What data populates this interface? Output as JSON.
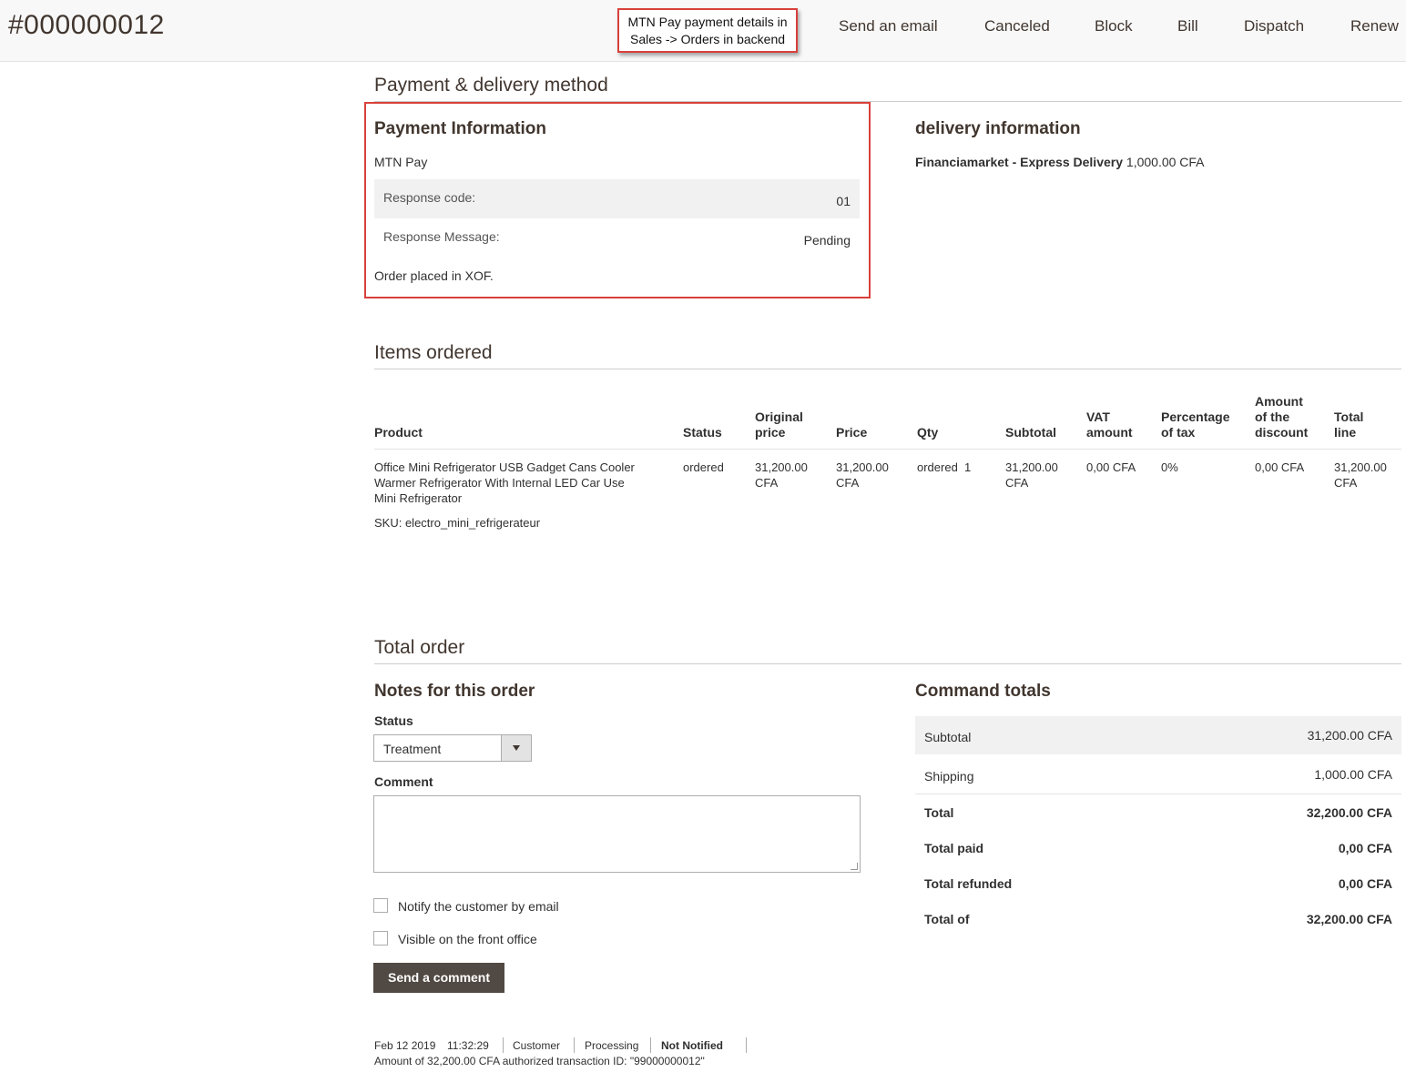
{
  "header": {
    "order_id": "#000000012",
    "callout": [
      "MTN Pay payment details in",
      "Sales -> Orders in backend"
    ],
    "actions": [
      "Send an email",
      "Canceled",
      "Block",
      "Bill",
      "Dispatch",
      "Renew"
    ]
  },
  "payment_delivery": {
    "section_title": "Payment & delivery method",
    "payment": {
      "title": "Payment Information",
      "method": "MTN Pay",
      "response_code_label": "Response code:",
      "response_code": "01",
      "response_message_label": "Response Message:",
      "response_message": "Pending",
      "currency_note": "Order placed in XOF."
    },
    "delivery": {
      "title": "delivery information",
      "method": "Financiamarket - Express Delivery",
      "amount": "1,000.00 CFA"
    }
  },
  "items": {
    "section_title": "Items ordered",
    "headers": {
      "product": "Product",
      "status": "Status",
      "original_price": [
        "Original",
        "price"
      ],
      "price": "Price",
      "qty": "Qty",
      "subtotal": "Subtotal",
      "vat": [
        "VAT",
        "amount"
      ],
      "tax_pct": [
        "Percentage",
        "of tax"
      ],
      "discount": [
        "Amount",
        "of the",
        "discount"
      ],
      "total": [
        "Total",
        "line"
      ]
    },
    "rows": [
      {
        "product_lines": [
          "Office Mini Refrigerator USB Gadget Cans Cooler",
          "Warmer Refrigerator With Internal LED Car Use",
          "Mini Refrigerator"
        ],
        "sku": "SKU: electro_mini_refrigerateur",
        "status": "ordered",
        "original_price": [
          "31,200.00",
          "CFA"
        ],
        "price": [
          "31,200.00",
          "CFA"
        ],
        "qty": "ordered  1",
        "subtotal": [
          "31,200.00",
          "CFA"
        ],
        "vat": "0,00 CFA",
        "tax_pct": "0%",
        "discount": "0,00 CFA",
        "total": [
          "31,200.00",
          "CFA"
        ]
      }
    ]
  },
  "total_order": {
    "section_title": "Total order",
    "notes": {
      "title": "Notes for this order",
      "status_label": "Status",
      "status_value": "Treatment",
      "comment_label": "Comment",
      "comment_value": "",
      "notify_label": "Notify the customer by email",
      "visible_label": "Visible on the front office",
      "submit_label": "Send a comment"
    },
    "totals": {
      "title": "Command totals",
      "subtotal_label": "Subtotal",
      "subtotal": "31,200.00 CFA",
      "shipping_label": "Shipping",
      "shipping": "1,000.00 CFA",
      "total_label": "Total",
      "total": "32,200.00 CFA",
      "paid_label": "Total paid",
      "paid": "0,00 CFA",
      "refunded_label": "Total refunded",
      "refunded": "0,00 CFA",
      "due_label": "Total of",
      "due": "32,200.00 CFA"
    },
    "history": {
      "date": "Feb 12 2019",
      "time": "11:32:29",
      "author": "Customer",
      "status": "Processing",
      "notified": "Not Notified",
      "message": "Amount of 32,200.00 CFA authorized transaction ID: \"99000000012\""
    }
  }
}
